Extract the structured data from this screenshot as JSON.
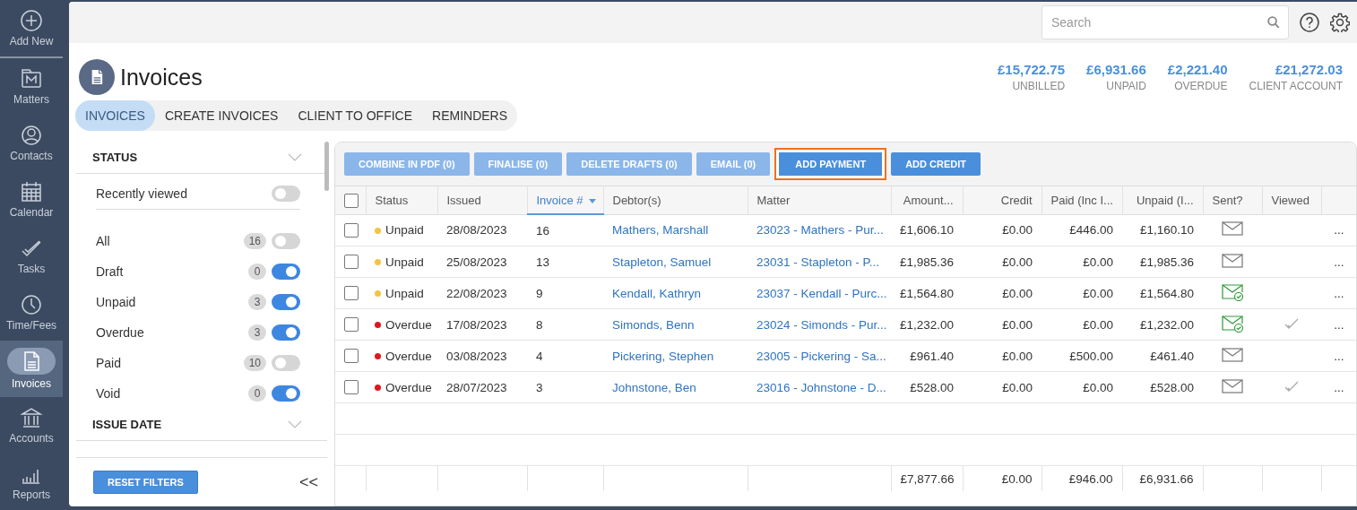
{
  "nav": {
    "add_new": "Add New",
    "items": [
      {
        "label": "Matters",
        "selected": false
      },
      {
        "label": "Contacts",
        "selected": false
      },
      {
        "label": "Calendar",
        "selected": false
      },
      {
        "label": "Tasks",
        "selected": false
      },
      {
        "label": "Time/Fees",
        "selected": false
      },
      {
        "label": "Invoices",
        "selected": true
      },
      {
        "label": "Accounts",
        "selected": false
      },
      {
        "label": "Reports",
        "selected": false
      }
    ]
  },
  "search": {
    "placeholder": "Search"
  },
  "page_title": "Invoices",
  "summary": [
    {
      "amount": "£15,722.75",
      "label": "UNBILLED"
    },
    {
      "amount": "£6,931.66",
      "label": "UNPAID"
    },
    {
      "amount": "£2,221.40",
      "label": "OVERDUE"
    },
    {
      "amount": "£21,272.03",
      "label": "CLIENT ACCOUNT"
    }
  ],
  "tabs": [
    {
      "label": "INVOICES",
      "selected": true
    },
    {
      "label": "CREATE INVOICES",
      "selected": false
    },
    {
      "label": "CLIENT TO OFFICE",
      "selected": false
    },
    {
      "label": "REMINDERS",
      "selected": false
    }
  ],
  "filters": {
    "sections": [
      {
        "title": "STATUS",
        "recent": {
          "label": "Recently viewed",
          "on": false
        },
        "items": [
          {
            "label": "All",
            "count": "16",
            "on": false
          },
          {
            "label": "Draft",
            "count": "0",
            "on": true
          },
          {
            "label": "Unpaid",
            "count": "3",
            "on": true
          },
          {
            "label": "Overdue",
            "count": "3",
            "on": true
          },
          {
            "label": "Paid",
            "count": "10",
            "on": false
          },
          {
            "label": "Void",
            "count": "0",
            "on": true
          }
        ]
      },
      {
        "title": "ISSUE DATE"
      }
    ],
    "reset": "RESET FILTERS",
    "collapse": "<<"
  },
  "toolbar": [
    {
      "label": "COMBINE IN PDF (0)",
      "disabled": true,
      "highlighted": false
    },
    {
      "label": "FINALISE (0)",
      "disabled": true,
      "highlighted": false
    },
    {
      "label": "DELETE DRAFTS (0)",
      "disabled": true,
      "highlighted": false
    },
    {
      "label": "EMAIL (0)",
      "disabled": true,
      "highlighted": false
    },
    {
      "label": "ADD PAYMENT",
      "disabled": false,
      "highlighted": true
    },
    {
      "label": "ADD CREDIT",
      "disabled": false,
      "highlighted": false
    }
  ],
  "table": {
    "all_checked": false,
    "columns": [
      {
        "label": "Status",
        "sorted": false
      },
      {
        "label": "Issued",
        "sorted": false
      },
      {
        "label": "Invoice #",
        "sorted": true
      },
      {
        "label": "Debtor(s)",
        "sorted": false
      },
      {
        "label": "Matter",
        "sorted": false
      },
      {
        "label": "Amount...",
        "sorted": false
      },
      {
        "label": "Credit",
        "sorted": false
      },
      {
        "label": "Paid (Inc I...",
        "sorted": false
      },
      {
        "label": "Unpaid (I...",
        "sorted": false
      },
      {
        "label": "Sent?",
        "sorted": false
      },
      {
        "label": "Viewed",
        "sorted": false
      }
    ],
    "rows": [
      {
        "checked": false,
        "status": "Unpaid",
        "color": "#f5c342",
        "issued": "28/08/2023",
        "invoice": "16",
        "debtor": "Mathers, Marshall",
        "matter": "23023 - Mathers - Pur...",
        "amount": "£1,606.10",
        "credit": "£0.00",
        "paid": "£446.00",
        "unpaid": "£1,160.10",
        "delivered": false,
        "viewed": false,
        "more": "..."
      },
      {
        "checked": false,
        "status": "Unpaid",
        "color": "#f5c342",
        "issued": "25/08/2023",
        "invoice": "13",
        "debtor": "Stapleton, Samuel",
        "matter": "23031 - Stapleton - P...",
        "amount": "£1,985.36",
        "credit": "£0.00",
        "paid": "£0.00",
        "unpaid": "£1,985.36",
        "delivered": false,
        "viewed": false,
        "more": "..."
      },
      {
        "checked": false,
        "status": "Unpaid",
        "color": "#f5c342",
        "issued": "22/08/2023",
        "invoice": "9",
        "debtor": "Kendall, Kathryn",
        "matter": "23037 - Kendall - Purc...",
        "amount": "£1,564.80",
        "credit": "£0.00",
        "paid": "£0.00",
        "unpaid": "£1,564.80",
        "delivered": true,
        "viewed": false,
        "more": "..."
      },
      {
        "checked": false,
        "status": "Overdue",
        "color": "#e0161d",
        "issued": "17/08/2023",
        "invoice": "8",
        "debtor": "Simonds, Benn",
        "matter": "23024 - Simonds - Pur...",
        "amount": "£1,232.00",
        "credit": "£0.00",
        "paid": "£0.00",
        "unpaid": "£1,232.00",
        "delivered": true,
        "viewed": true,
        "more": "..."
      },
      {
        "checked": false,
        "status": "Overdue",
        "color": "#e0161d",
        "issued": "03/08/2023",
        "invoice": "4",
        "debtor": "Pickering, Stephen",
        "matter": "23005 - Pickering - Sa...",
        "amount": "£961.40",
        "credit": "£0.00",
        "paid": "£500.00",
        "unpaid": "£461.40",
        "delivered": false,
        "viewed": false,
        "more": "..."
      },
      {
        "checked": false,
        "status": "Overdue",
        "color": "#e0161d",
        "issued": "28/07/2023",
        "invoice": "3",
        "debtor": "Johnstone, Ben",
        "matter": "23016 - Johnstone - D...",
        "amount": "£528.00",
        "credit": "£0.00",
        "paid": "£0.00",
        "unpaid": "£528.00",
        "delivered": false,
        "viewed": true,
        "more": "..."
      }
    ],
    "totals": {
      "amount": "£7,877.66",
      "credit": "£0.00",
      "paid": "£946.00",
      "unpaid": "£6,931.66"
    }
  }
}
